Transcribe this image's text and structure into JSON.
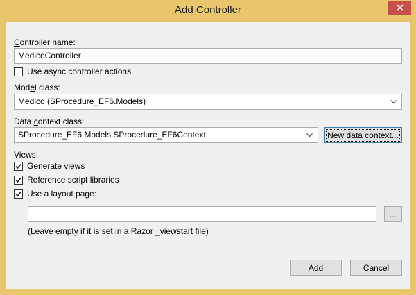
{
  "window": {
    "title": "Add Controller",
    "accent_color": "#e9c56b",
    "close_color": "#c7504b"
  },
  "controller_name": {
    "label_u": "C",
    "label_rest": "ontroller name:",
    "value": "MedicoController"
  },
  "async_checkbox": {
    "label": "Use async controller actions",
    "checked": false
  },
  "model_class": {
    "label_pre": "Mod",
    "label_u": "e",
    "label_post": "l class:",
    "value": "Medico (SProcedure_EF6.Models)"
  },
  "data_context": {
    "label_pre": "Data ",
    "label_u": "c",
    "label_post": "ontext class:",
    "value": "SProcedure_EF6.Models.SProcedure_EF6Context",
    "new_button": "New data context..."
  },
  "views": {
    "label": "Views:",
    "generate": {
      "label": "Generate views",
      "checked": true
    },
    "reference": {
      "label": "Reference script libraries",
      "checked": true
    },
    "layout": {
      "label": "Use a layout page:",
      "checked": true
    },
    "layout_path": "",
    "browse_button": "...",
    "hint": "(Leave empty if it is set in a Razor _viewstart file)"
  },
  "footer": {
    "add_button": "Add",
    "cancel_button": "Cancel"
  }
}
